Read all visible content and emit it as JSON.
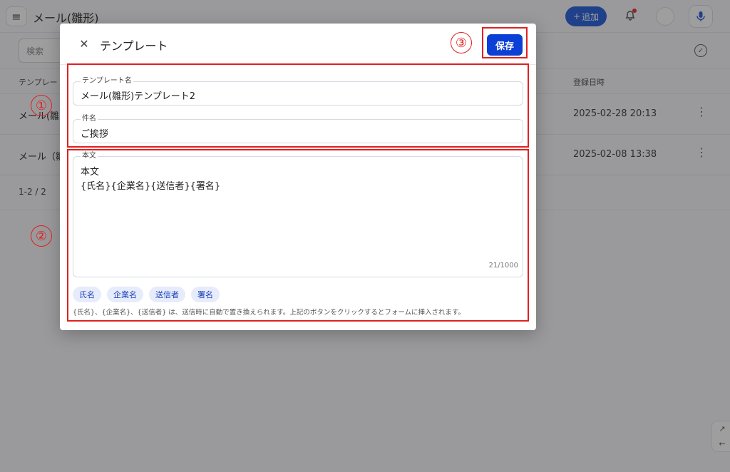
{
  "app": {
    "page_title": "メール(雛形)",
    "add_label": "追加",
    "add_icon": "+",
    "search_placeholder": "検索",
    "table": {
      "headers": {
        "template": "テンプレート",
        "date": "登録日時"
      },
      "rows": [
        {
          "name": "メール(雛",
          "date": "2025-02-28 20:13"
        },
        {
          "name": "メール（雛",
          "date": "2025-02-08 13:38"
        }
      ],
      "more_icon": "⋮"
    },
    "pager": "1-2 / 2"
  },
  "modal": {
    "title": "テンプレート",
    "save_label": "保存",
    "close_icon": "✕",
    "fields": {
      "template_name": {
        "label": "テンプレート名",
        "value": "メール(雛形)テンプレート2"
      },
      "subject": {
        "label": "件名",
        "value": "ご挨拶"
      },
      "body": {
        "label": "本文",
        "value": "本文\n{氏名}{企業名}{送信者}{署名}",
        "counter": "21/1000"
      }
    },
    "chips": [
      "氏名",
      "企業名",
      "送信者",
      "署名"
    ],
    "help_text": "{氏名}、{企業名}、{送信者} は、送信時に自動で置き換えられます。上記のボタンをクリックするとフォームに挿入されます。"
  },
  "annotations": {
    "n1": "①",
    "n2": "②",
    "n3": "③"
  },
  "colors": {
    "primary": "#0b3fd6",
    "annotation": "#e02020",
    "chip_bg": "#e6ecfb"
  }
}
